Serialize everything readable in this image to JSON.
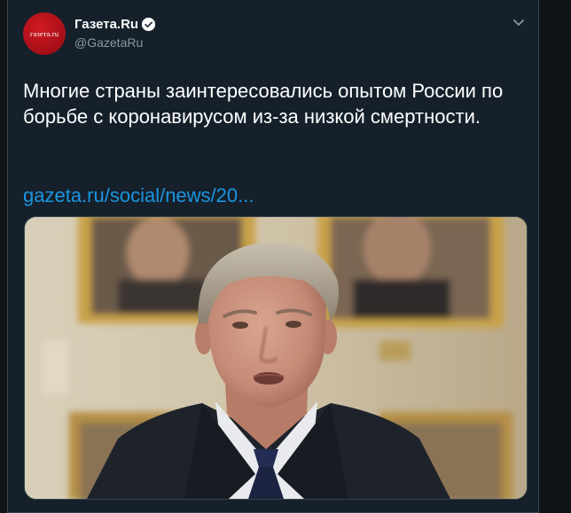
{
  "tweet": {
    "author": {
      "display_name": "Газета.Ru",
      "handle": "@GazetaRu",
      "avatar_text": "газета.ru",
      "verified": true
    },
    "text": "Многие страны заинтересовались опытом России по борьбе с коронавирусом из-за низкой смертности.",
    "link": "gazeta.ru/social/news/20...",
    "media": {
      "icon": "photo-of-man-in-suit"
    }
  },
  "colors": {
    "background": "#15202b",
    "text": "#ffffff",
    "secondary": "#8899a6",
    "link": "#1b95e0",
    "verified": "#1da1f2",
    "avatar": "#c8141d"
  }
}
